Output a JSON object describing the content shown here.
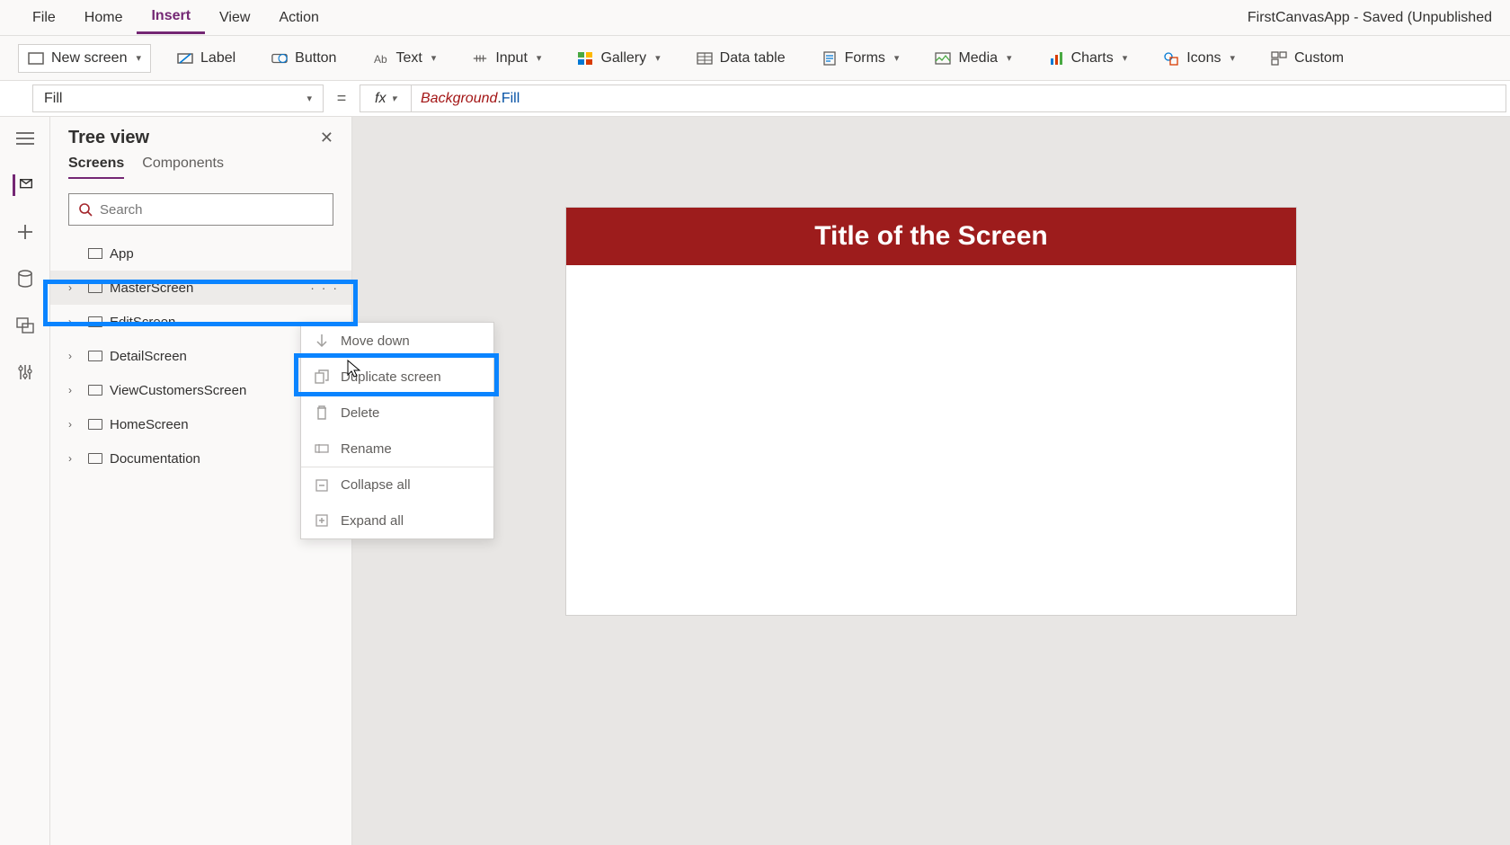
{
  "menu": {
    "items": [
      "File",
      "Home",
      "Insert",
      "View",
      "Action"
    ],
    "active": "Insert",
    "app_title": "FirstCanvasApp - Saved (Unpublished"
  },
  "ribbon": {
    "new_screen": "New screen",
    "label": "Label",
    "button": "Button",
    "text": "Text",
    "input": "Input",
    "gallery": "Gallery",
    "data_table": "Data table",
    "forms": "Forms",
    "media": "Media",
    "charts": "Charts",
    "icons": "Icons",
    "custom": "Custom"
  },
  "formula": {
    "property": "Fill",
    "equals": "=",
    "fx": "fx",
    "token1": "Background",
    "dot": ".",
    "token2": "Fill"
  },
  "tree": {
    "title": "Tree view",
    "tabs": {
      "screens": "Screens",
      "components": "Components"
    },
    "search_placeholder": "Search",
    "app_label": "App",
    "items": [
      {
        "label": "MasterScreen",
        "selected": true
      },
      {
        "label": "EditScreen"
      },
      {
        "label": "DetailScreen"
      },
      {
        "label": "ViewCustomersScreen"
      },
      {
        "label": "HomeScreen"
      },
      {
        "label": "Documentation"
      }
    ],
    "more": "· · ·"
  },
  "context_menu": {
    "items": [
      {
        "label": "Move down",
        "icon": "arrow-down"
      },
      {
        "label": "Duplicate screen",
        "icon": "copy",
        "highlighted": true
      },
      {
        "label": "Delete",
        "icon": "trash"
      },
      {
        "label": "Rename",
        "icon": "rename"
      },
      {
        "label": "Collapse all",
        "icon": "collapse",
        "sep": true
      },
      {
        "label": "Expand all",
        "icon": "expand"
      }
    ]
  },
  "canvas": {
    "header_text": "Title of the Screen"
  }
}
